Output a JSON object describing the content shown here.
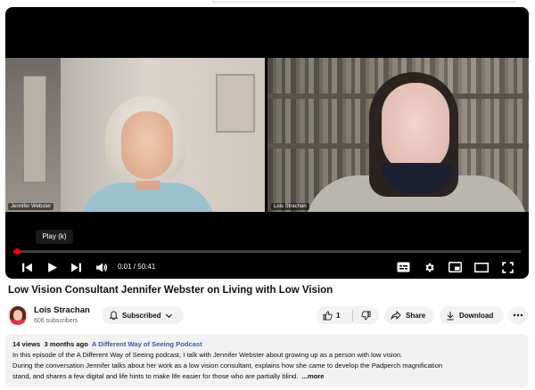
{
  "player": {
    "tooltip": "Play (k)",
    "progress_fraction": 0.0003,
    "current_time": "0:01",
    "duration": "50:41",
    "participants": [
      {
        "name": "Jennifer Webster"
      },
      {
        "name": "Lois Strachan"
      }
    ],
    "icons": {
      "previous": "skip-previous-icon",
      "play": "play-icon",
      "next": "skip-next-icon",
      "volume": "volume-icon",
      "captions": "captions-icon",
      "settings": "gear-icon",
      "miniplayer": "miniplayer-icon",
      "theater": "theater-mode-icon",
      "fullscreen": "fullscreen-icon"
    }
  },
  "video": {
    "title": "Low Vision Consultant Jennifer Webster on Living with Low Vision"
  },
  "channel": {
    "name": "Lois Strachan",
    "subscribers": "606 subscribers",
    "subscribed_label": "Subscribed"
  },
  "actions": {
    "like_count": "1",
    "share_label": "Share",
    "download_label": "Download"
  },
  "description": {
    "views": "14 views",
    "age": "3 months ago",
    "tag": "A Different Way of Seeing Podcast",
    "line1": "In this episode of the A Different Way of Seeing podcast, I talk with Jennifer Webster about growing up as a person with low vision.",
    "line2": "During the conversation Jennifer talks about her work as a low vision consultant, explains how she came to develop the Padperch magnification",
    "line3": "stand, and shares a few digital and life hints to make life easier for those who are partially blind.",
    "more_label": "...more"
  }
}
